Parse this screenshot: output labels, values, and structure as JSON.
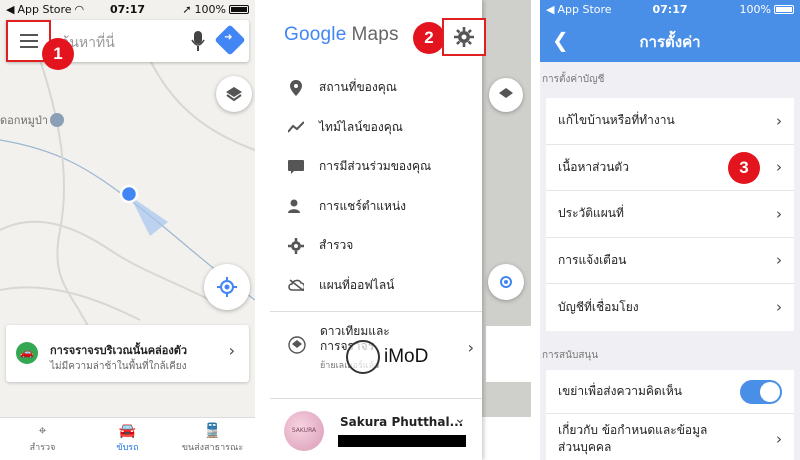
{
  "colors": {
    "accent": "#4285f4",
    "highlight": "#e02020",
    "step_badge": "#e3141e",
    "settings_bar": "#4a8fe7"
  },
  "status_bar": {
    "back_app": "App Store",
    "time": "07:17",
    "battery": "100%"
  },
  "panel1": {
    "step": "1",
    "search_placeholder": "ค้นหาที่นี่",
    "place_label": "ดอกหมูป่า",
    "traffic_card": {
      "title": "การจราจรบริเวณนั้นคล่องตัว",
      "subtitle": "ไม่มีความล่าช้าในพื้นที่ใกล้เคียง"
    },
    "nav": [
      {
        "label": "สำรวจ",
        "icon": "explore-icon"
      },
      {
        "label": "ขับรถ",
        "icon": "car-icon"
      },
      {
        "label": "ขนส่งสาธารณะ",
        "icon": "transit-icon"
      }
    ]
  },
  "panel2": {
    "step": "2",
    "logo": {
      "google": "Google",
      "maps": "Maps"
    },
    "menu": [
      {
        "label": "สถานที่ของคุณ",
        "icon": "place-pin-icon"
      },
      {
        "label": "ไทม์ไลน์ของคุณ",
        "icon": "timeline-icon"
      },
      {
        "label": "การมีส่วนร่วมของคุณ",
        "icon": "contribute-icon"
      },
      {
        "label": "การแชร์ตำแหน่ง",
        "icon": "location-share-icon"
      },
      {
        "label": "สำรวจ",
        "icon": "explore-gear-icon"
      },
      {
        "label": "แผนที่ออฟไลน์",
        "icon": "offline-cloud-icon"
      }
    ],
    "bottom_item": {
      "title_line1": "ดาวเทียมและ",
      "title_line2": "การจราจร",
      "subtitle": "ย้ายเลเยอร์แล้ว"
    },
    "account_name": "Sakura Phutthal...",
    "watermark": "iMoD"
  },
  "panel3": {
    "title": "การตั้งค่า",
    "step": "3",
    "section1": "การตั้งค่าบัญชี",
    "account_rows": [
      "แก้ไขบ้านหรือที่ทำงาน",
      "เนื้อหาส่วนตัว",
      "ประวัติแผนที่",
      "การแจ้งเตือน",
      "บัญชีที่เชื่อมโยง"
    ],
    "section2": "การสนับสนุน",
    "support_rows": [
      {
        "label": "เขย่าเพื่อส่งความคิดเห็น",
        "toggle": true
      },
      {
        "label_line1": "เกี่ยวกับ ข้อกำหนดและข้อมูล",
        "label_line2": "ส่วนบุคคล"
      }
    ]
  }
}
